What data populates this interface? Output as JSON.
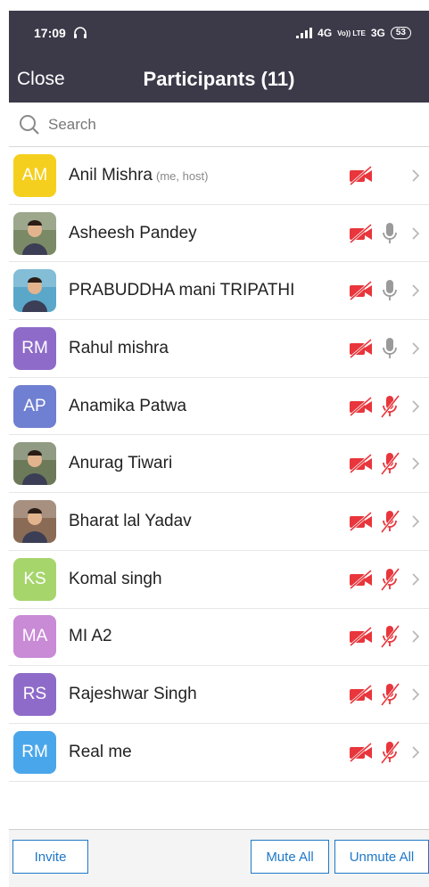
{
  "status_bar": {
    "time": "17:09",
    "network": "4G",
    "network2": "3G",
    "volte": "Vo)) LTE",
    "battery": "53"
  },
  "header": {
    "close_label": "Close",
    "title": "Participants (11)"
  },
  "search": {
    "placeholder": "Search"
  },
  "participants": [
    {
      "name": "Anil Mishra",
      "tag": "(me, host)",
      "initials": "AM",
      "avatar_color": "#f5cf1d",
      "avatar_type": "initials",
      "video": "off",
      "audio": "none"
    },
    {
      "name": "Asheesh Pandey",
      "tag": "",
      "initials": "",
      "avatar_color": "#7b8a66",
      "avatar_type": "photo",
      "video": "off",
      "audio": "on"
    },
    {
      "name": "PRABUDDHA mani TRIPATHI",
      "tag": "",
      "initials": "",
      "avatar_color": "#5aa7c9",
      "avatar_type": "photo",
      "video": "off",
      "audio": "on"
    },
    {
      "name": "Rahul mishra",
      "tag": "",
      "initials": "RM",
      "avatar_color": "#8e6bc9",
      "avatar_type": "initials",
      "video": "off",
      "audio": "on"
    },
    {
      "name": "Anamika Patwa",
      "tag": "",
      "initials": "AP",
      "avatar_color": "#6f7fd1",
      "avatar_type": "initials",
      "video": "off",
      "audio": "muted"
    },
    {
      "name": "Anurag Tiwari",
      "tag": "",
      "initials": "",
      "avatar_color": "#6d7a5a",
      "avatar_type": "photo",
      "video": "off",
      "audio": "muted"
    },
    {
      "name": "Bharat lal Yadav",
      "tag": "",
      "initials": "",
      "avatar_color": "#8a6b56",
      "avatar_type": "photo",
      "video": "off",
      "audio": "muted"
    },
    {
      "name": "Komal singh",
      "tag": "",
      "initials": "KS",
      "avatar_color": "#a6d56c",
      "avatar_type": "initials",
      "video": "off",
      "audio": "muted"
    },
    {
      "name": "MI A2",
      "tag": "",
      "initials": "MA",
      "avatar_color": "#c98ad6",
      "avatar_type": "initials",
      "video": "off",
      "audio": "muted"
    },
    {
      "name": "Rajeshwar Singh",
      "tag": "",
      "initials": "RS",
      "avatar_color": "#8e6bc9",
      "avatar_type": "initials",
      "video": "off",
      "audio": "muted"
    },
    {
      "name": "Real me",
      "tag": "",
      "initials": "RM",
      "avatar_color": "#4aa6ea",
      "avatar_type": "initials",
      "video": "off",
      "audio": "muted"
    }
  ],
  "footer": {
    "invite_label": "Invite",
    "mute_all_label": "Mute All",
    "unmute_all_label": "Unmute All"
  },
  "colors": {
    "header_bg": "#3c3a49",
    "accent": "#1f78c8",
    "muted_red": "#e8363c",
    "mic_gray": "#9a9a9a"
  },
  "icons": {
    "search": "search-icon",
    "video_off": "video-off-icon",
    "mic": "microphone-icon",
    "mic_off": "microphone-muted-icon",
    "chevron": "chevron-right-icon"
  }
}
